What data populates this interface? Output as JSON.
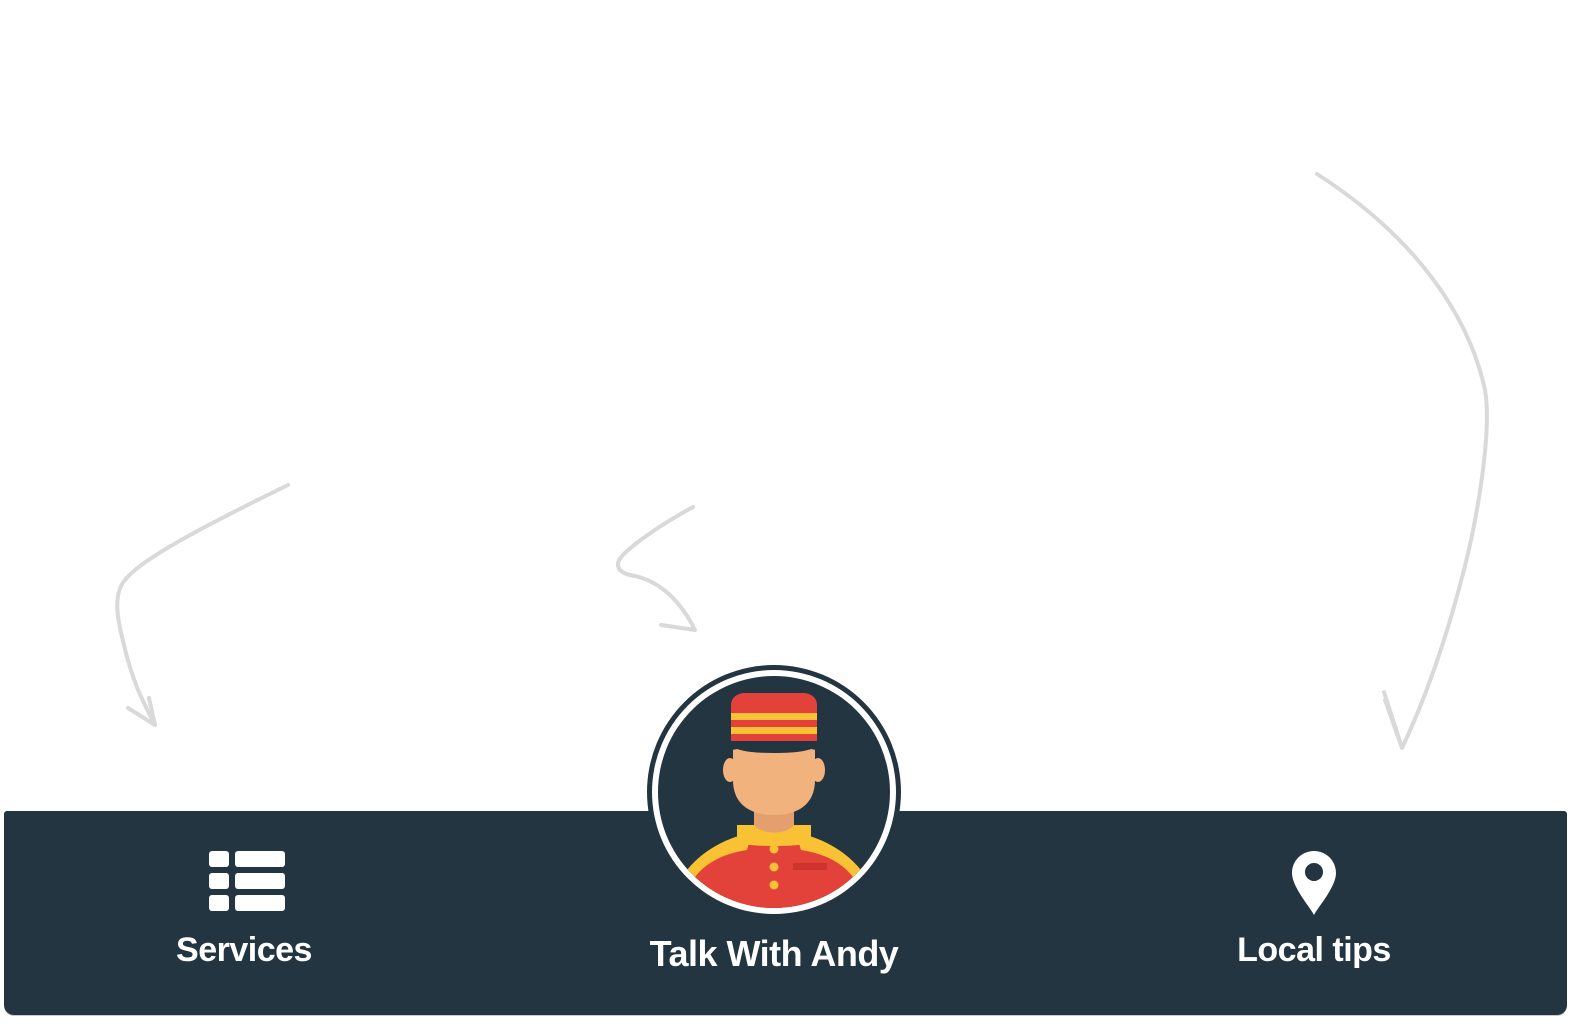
{
  "colors": {
    "tabbar_background": "#233540",
    "tab_text": "#ffffff",
    "arrow_stroke": "#d9d9d9",
    "avatar_background": "#233540",
    "avatar_ring": "#ffffff",
    "uniform_red": "#e3423b",
    "uniform_yellow": "#f9c235",
    "skin": "#f2b27e"
  },
  "tabbar": {
    "tabs": [
      {
        "label": "Services",
        "icon": "list-icon"
      },
      {
        "label": "Talk With Andy",
        "icon": "bellhop-avatar"
      },
      {
        "label": "Local tips",
        "icon": "map-pin-icon"
      }
    ]
  }
}
